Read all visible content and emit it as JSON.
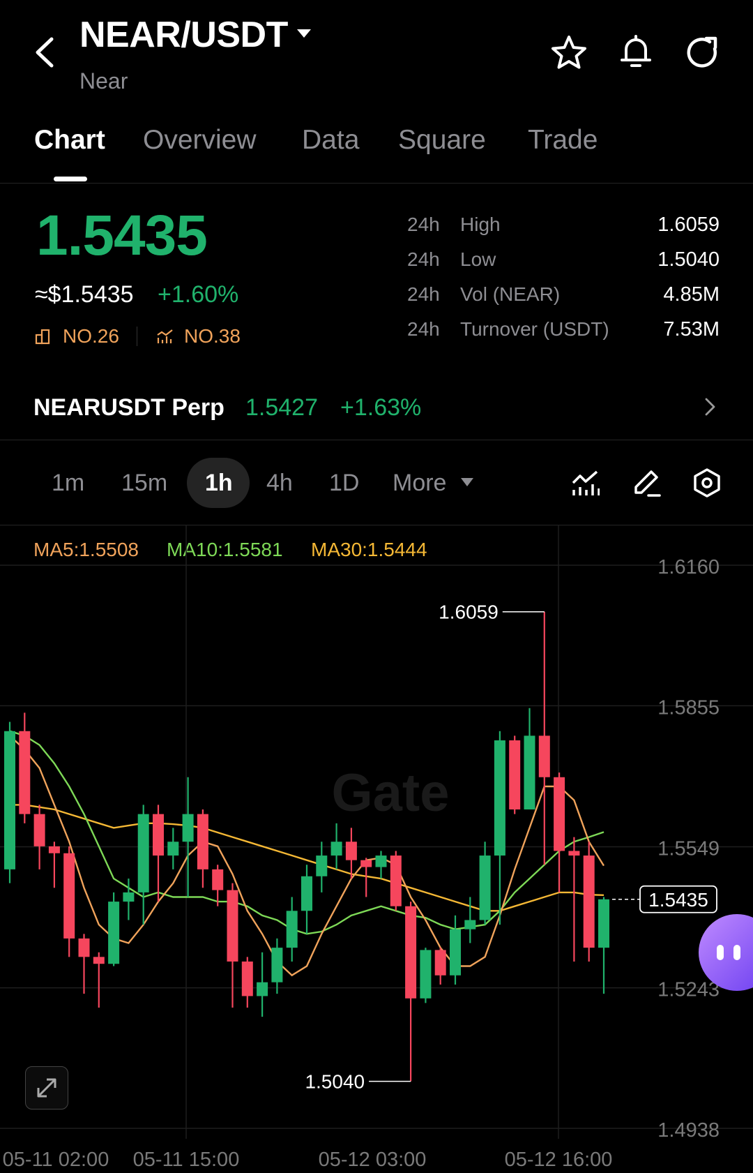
{
  "header": {
    "pair": "NEAR/USDT",
    "name": "Near"
  },
  "tabs": [
    {
      "label": "Chart",
      "active": true
    },
    {
      "label": "Overview"
    },
    {
      "label": "Data"
    },
    {
      "label": "Square"
    },
    {
      "label": "Trade"
    }
  ],
  "price": {
    "last": "1.5435",
    "usd": "≈$1.5435",
    "change": "+1.60%",
    "rank1": "NO.26",
    "rank2": "NO.38"
  },
  "stats": [
    {
      "period": "24h",
      "label": "High",
      "value": "1.6059"
    },
    {
      "period": "24h",
      "label": "Low",
      "value": "1.5040"
    },
    {
      "period": "24h",
      "label": "Vol (NEAR)",
      "value": "4.85M"
    },
    {
      "period": "24h",
      "label": "Turnover (USDT)",
      "value": "7.53M"
    }
  ],
  "perp": {
    "name": "NEARUSDT Perp",
    "price": "1.5427",
    "change": "+1.63%"
  },
  "intervals": [
    "1m",
    "15m",
    "1h",
    "4h",
    "1D",
    "More"
  ],
  "active_interval": "1h",
  "ma": {
    "ma5": "MA5:1.5508",
    "ma10": "MA10:1.5581",
    "ma30": "MA30:1.5444"
  },
  "watermark": "Gate",
  "colors": {
    "up": "#20b26c",
    "down": "#f6465d",
    "ma5": "#f0a35b",
    "ma10": "#7ed957",
    "ma30": "#f5b835"
  },
  "chart_data": {
    "type": "candlestick",
    "y_ticks": [
      "1.6160",
      "1.5855",
      "1.5549",
      "1.5243",
      "1.4938"
    ],
    "ylim": [
      1.4938,
      1.616
    ],
    "x_ticks": [
      "05-11 02:00",
      "05-11 15:00",
      "05-12 03:00",
      "05-12 16:00"
    ],
    "high_label": "1.6059",
    "low_label": "1.5040",
    "last_label": "1.5435",
    "candles": [
      [
        1.55,
        1.58,
        1.547,
        1.582
      ],
      [
        1.58,
        1.562,
        1.56,
        1.584
      ],
      [
        1.562,
        1.555,
        1.55,
        1.564
      ],
      [
        1.555,
        1.5535,
        1.546,
        1.556
      ],
      [
        1.5535,
        1.535,
        1.531,
        1.555
      ],
      [
        1.535,
        1.531,
        1.523,
        1.536
      ],
      [
        1.531,
        1.5295,
        1.52,
        1.532
      ],
      [
        1.5295,
        1.543,
        1.529,
        1.545
      ],
      [
        1.543,
        1.545,
        1.539,
        1.548
      ],
      [
        1.545,
        1.562,
        1.538,
        1.564
      ],
      [
        1.562,
        1.553,
        1.543,
        1.564
      ],
      [
        1.553,
        1.556,
        1.55,
        1.559
      ],
      [
        1.556,
        1.562,
        1.544,
        1.57
      ],
      [
        1.562,
        1.55,
        1.546,
        1.563
      ],
      [
        1.55,
        1.5455,
        1.542,
        1.551
      ],
      [
        1.5455,
        1.53,
        1.52,
        1.547
      ],
      [
        1.53,
        1.5225,
        1.52,
        1.531
      ],
      [
        1.5225,
        1.5255,
        1.518,
        1.532
      ],
      [
        1.5255,
        1.533,
        1.523,
        1.535
      ],
      [
        1.533,
        1.541,
        1.53,
        1.544
      ],
      [
        1.541,
        1.5485,
        1.536,
        1.551
      ],
      [
        1.5485,
        1.553,
        1.545,
        1.556
      ],
      [
        1.553,
        1.556,
        1.55,
        1.56
      ],
      [
        1.556,
        1.552,
        1.548,
        1.559
      ],
      [
        1.552,
        1.5505,
        1.544,
        1.5525
      ],
      [
        1.5505,
        1.553,
        1.548,
        1.554
      ],
      [
        1.553,
        1.542,
        1.541,
        1.554
      ],
      [
        1.542,
        1.522,
        1.504,
        1.543
      ],
      [
        1.522,
        1.5325,
        1.521,
        1.533
      ],
      [
        1.5325,
        1.527,
        1.525,
        1.533
      ],
      [
        1.527,
        1.537,
        1.525,
        1.54
      ],
      [
        1.537,
        1.539,
        1.534,
        1.544
      ],
      [
        1.539,
        1.553,
        1.538,
        1.556
      ],
      [
        1.553,
        1.578,
        1.538,
        1.58
      ],
      [
        1.578,
        1.563,
        1.562,
        1.579
      ],
      [
        1.563,
        1.579,
        1.563,
        1.585
      ],
      [
        1.579,
        1.57,
        1.551,
        1.6059
      ],
      [
        1.57,
        1.554,
        1.545,
        1.571
      ],
      [
        1.554,
        1.553,
        1.53,
        1.557
      ],
      [
        1.553,
        1.533,
        1.53,
        1.556
      ],
      [
        1.533,
        1.5435,
        1.523,
        1.544
      ]
    ],
    "ma5": [
      1.579,
      1.576,
      1.572,
      1.564,
      1.556,
      1.546,
      1.538,
      1.535,
      1.534,
      1.538,
      1.543,
      1.547,
      1.553,
      1.556,
      1.555,
      1.549,
      1.541,
      1.536,
      1.53,
      1.527,
      1.529,
      1.536,
      1.542,
      1.548,
      1.552,
      1.5525,
      1.551,
      1.544,
      1.539,
      1.533,
      1.529,
      1.529,
      1.531,
      1.54,
      1.55,
      1.559,
      1.568,
      1.568,
      1.565,
      1.556,
      1.5508
    ],
    "ma10": [
      1.58,
      1.579,
      1.577,
      1.573,
      1.568,
      1.562,
      1.555,
      1.548,
      1.546,
      1.544,
      1.545,
      1.544,
      1.544,
      1.544,
      1.543,
      1.543,
      1.542,
      1.54,
      1.539,
      1.537,
      1.536,
      1.5365,
      1.538,
      1.54,
      1.541,
      1.542,
      1.541,
      1.54,
      1.5395,
      1.538,
      1.537,
      1.5375,
      1.538,
      1.541,
      1.545,
      1.548,
      1.551,
      1.554,
      1.556,
      1.557,
      1.5581
    ],
    "ma30": [
      1.564,
      1.564,
      1.5635,
      1.563,
      1.562,
      1.561,
      1.56,
      1.559,
      1.5595,
      1.56,
      1.56,
      1.5598,
      1.5595,
      1.559,
      1.558,
      1.557,
      1.556,
      1.555,
      1.554,
      1.553,
      1.552,
      1.551,
      1.55,
      1.549,
      1.5485,
      1.548,
      1.547,
      1.546,
      1.545,
      1.544,
      1.543,
      1.542,
      1.541,
      1.541,
      1.542,
      1.543,
      1.544,
      1.545,
      1.545,
      1.5445,
      1.5444
    ]
  }
}
